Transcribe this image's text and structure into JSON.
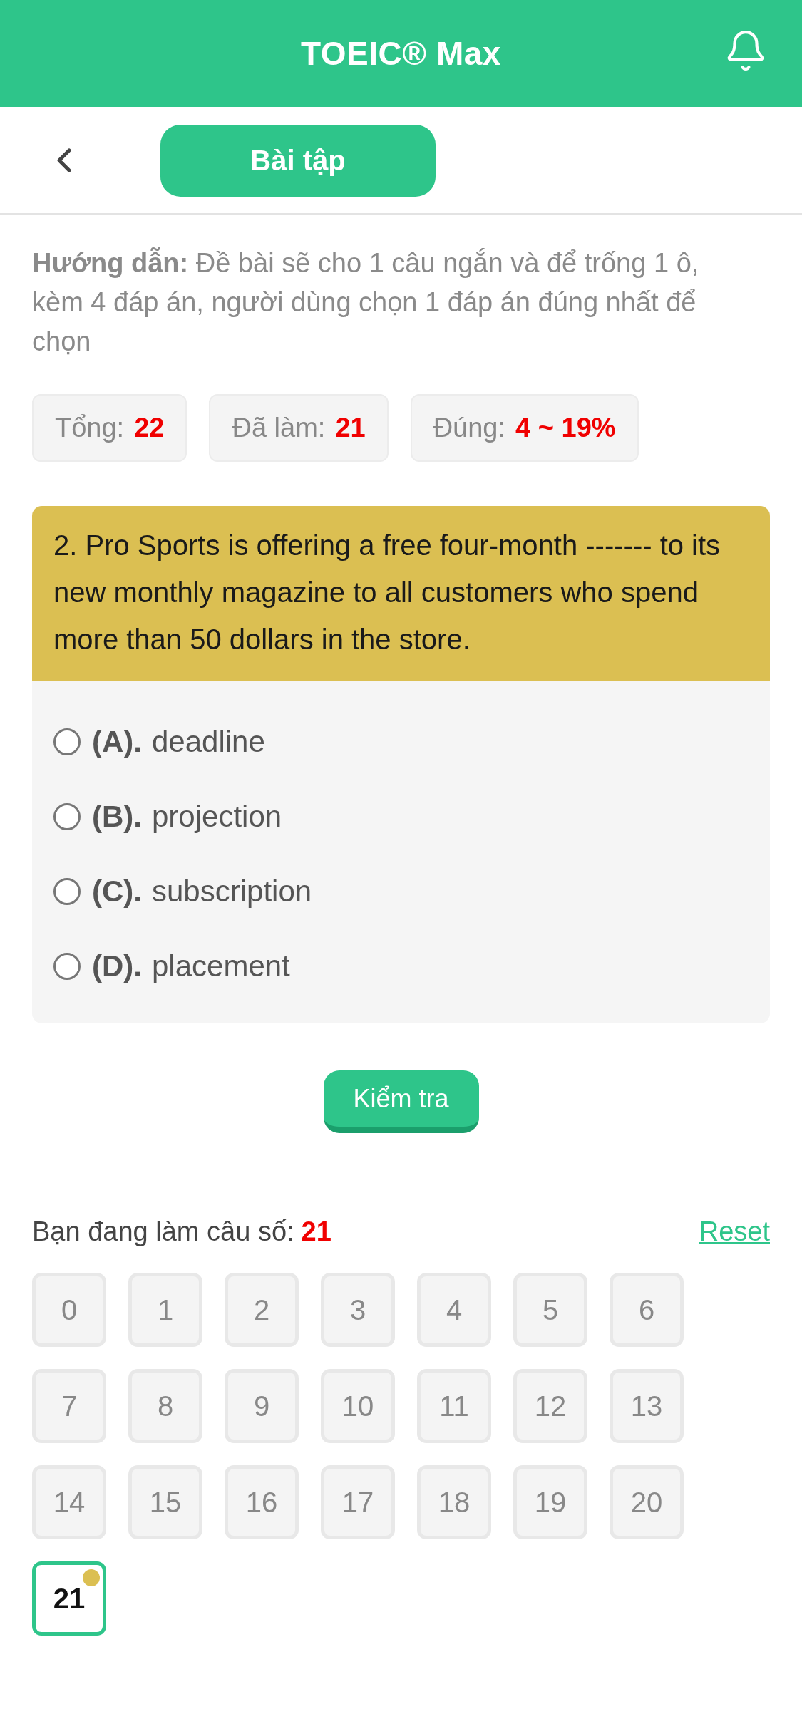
{
  "header": {
    "title": "TOEIC® Max"
  },
  "nav": {
    "tab": "Bài tập"
  },
  "instructions": {
    "text": "**Hướng dẫn:** Đề bài sẽ cho 1 câu ngắn và để trống 1 ô, kèm 4 đáp án, người dùng chọn 1 đáp án đúng nhất để chọn"
  },
  "stats": [
    {
      "label": "Tổng:",
      "value": "22"
    },
    {
      "label": "Đã làm:",
      "value": "21"
    },
    {
      "label": "Đúng:",
      "value": "4 ~ 19%"
    }
  ],
  "question": {
    "text": "2. Pro Sports is offering a free four-month ------- to its new monthly magazine to all customers who spend more than 50 dollars in the store.",
    "options": [
      {
        "letter": "(A).",
        "text": "deadline",
        "selected": false
      },
      {
        "letter": "(B).",
        "text": "projection",
        "selected": false
      },
      {
        "letter": "(C).",
        "text": "subscription",
        "selected": false
      },
      {
        "letter": "(D).",
        "text": "placement",
        "selected": false
      }
    ]
  },
  "check_button": "Kiểm tra",
  "progress": {
    "label": "Bạn đang làm câu số:",
    "value": "21",
    "reset": "Reset"
  },
  "question_grid": [
    {
      "number": "0",
      "selected": false
    },
    {
      "number": "1",
      "selected": false
    },
    {
      "number": "2",
      "selected": false
    },
    {
      "number": "3",
      "selected": false
    },
    {
      "number": "4",
      "selected": false
    },
    {
      "number": "5",
      "selected": false
    },
    {
      "number": "6",
      "selected": false
    },
    {
      "number": "7",
      "selected": false
    },
    {
      "number": "8",
      "selected": false
    },
    {
      "number": "9",
      "selected": false
    },
    {
      "number": "10",
      "selected": false
    },
    {
      "number": "11",
      "selected": false
    },
    {
      "number": "12",
      "selected": false
    },
    {
      "number": "13",
      "selected": false
    },
    {
      "number": "14",
      "selected": false
    },
    {
      "number": "15",
      "selected": false
    },
    {
      "number": "16",
      "selected": false
    },
    {
      "number": "17",
      "selected": false
    },
    {
      "number": "18",
      "selected": false
    },
    {
      "number": "19",
      "selected": false
    },
    {
      "number": "20",
      "selected": false
    },
    {
      "number": "21",
      "selected": true
    }
  ]
}
